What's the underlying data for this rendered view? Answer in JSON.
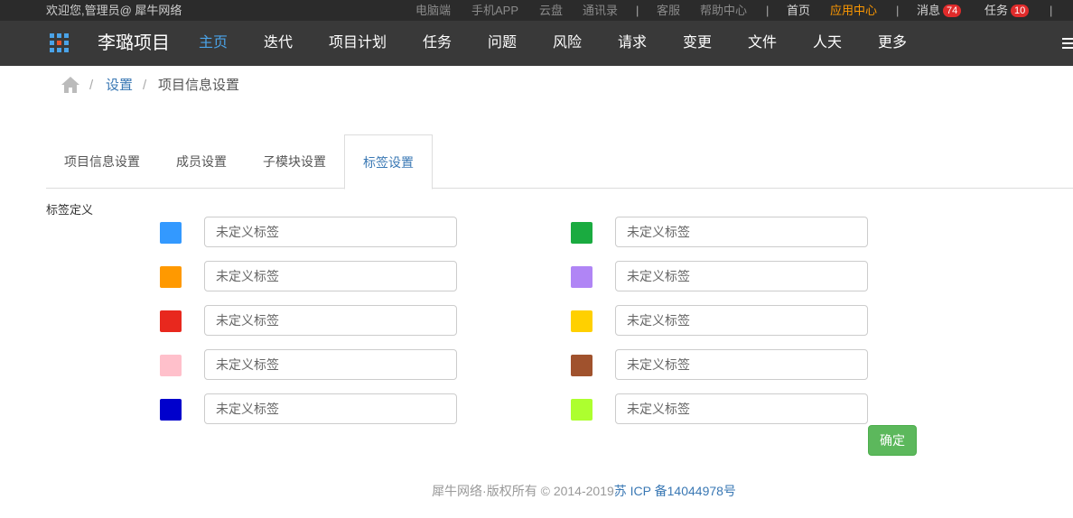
{
  "topbar": {
    "welcome": "欢迎您,管理员@ 犀牛网络",
    "links": [
      "电脑端",
      "手机APP",
      "云盘",
      "通讯录"
    ],
    "links2": [
      "客服",
      "帮助中心"
    ],
    "home": "首页",
    "app_center": "应用中心",
    "messages_label": "消息",
    "messages_count": "74",
    "tasks_label": "任务",
    "tasks_count": "10",
    "separator": "|"
  },
  "navbar": {
    "apps_icon": "grid-icon",
    "project_title": "李璐项目",
    "items": [
      "主页",
      "迭代",
      "项目计划",
      "任务",
      "问题",
      "风险",
      "请求",
      "变更",
      "文件",
      "人天",
      "更多"
    ],
    "active_index": 0,
    "menu_icon": "hamburger-icon"
  },
  "breadcrumb": {
    "home_icon": "home-icon",
    "separator": "/",
    "parent": "设置",
    "current": "项目信息设置"
  },
  "tabs": [
    "项目信息设置",
    "成员设置",
    "子模块设置",
    "标签设置"
  ],
  "active_tab": 3,
  "section_label": "标签定义",
  "tags": [
    {
      "color": "#3399ff",
      "placeholder": "未定义标签"
    },
    {
      "color": "#1aab40",
      "placeholder": "未定义标签"
    },
    {
      "color": "#ff9900",
      "placeholder": "未定义标签"
    },
    {
      "color": "#b085f5",
      "placeholder": "未定义标签"
    },
    {
      "color": "#e8281e",
      "placeholder": "未定义标签"
    },
    {
      "color": "#ffd000",
      "placeholder": "未定义标签"
    },
    {
      "color": "#ffc0cb",
      "placeholder": "未定义标签"
    },
    {
      "color": "#a0522d",
      "placeholder": "未定义标签"
    },
    {
      "color": "#0000cc",
      "placeholder": "未定义标签"
    },
    {
      "color": "#adff2f",
      "placeholder": "未定义标签"
    }
  ],
  "confirm_label": "确定",
  "footer": {
    "copyright": "犀牛网络·版权所有 © 2014-2019",
    "icp": "苏 ICP 备14044978号"
  }
}
